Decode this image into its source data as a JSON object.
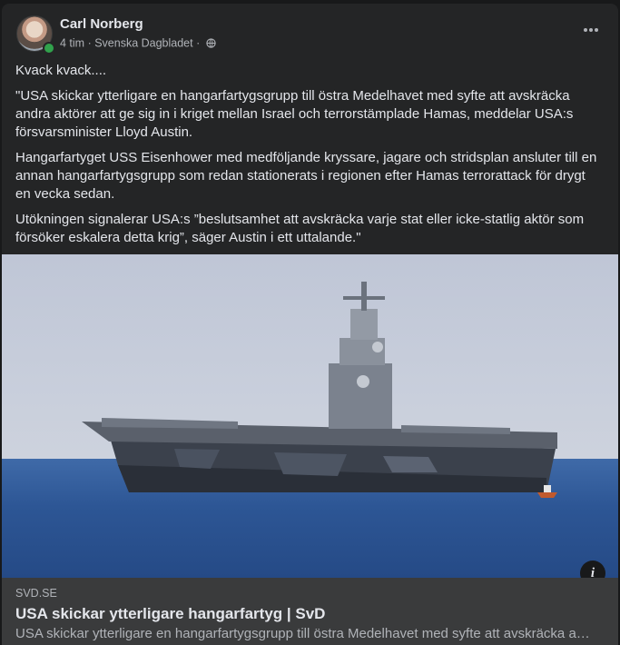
{
  "post": {
    "author": "Carl Norberg",
    "time": "4 tim",
    "separator": " · ",
    "source": "Svenska Dagbladet",
    "privacy_icon": "globe-icon",
    "more_icon": "more-horizontal-icon",
    "paragraphs": [
      "Kvack kvack....",
      "\"USA skickar ytterligare en hangarfartygsgrupp till östra Medelhavet med syfte att avskräcka andra aktörer att ge sig in i kriget mellan Israel och terrorstämplade Hamas, meddelar USA:s försvarsminister Lloyd Austin.",
      "Hangarfartyget USS Eisenhower med medföljande kryssare, jagare och stridsplan ansluter till en annan hangarfartygsgrupp som redan stationerats i regionen efter Hamas terrorattack för drygt en vecka sedan.",
      "Utökningen signalerar USA:s ”beslutsamhet att avskräcka varje stat eller icke-statlig aktör som försöker eskalera detta krig”, säger Austin i ett uttalande.\""
    ]
  },
  "link_preview": {
    "domain": "SVD.SE",
    "title": "USA skickar ytterligare hangarfartyg | SvD",
    "description": "USA skickar ytterligare en hangarfartygsgrupp till östra Medelhavet med syfte att avskräcka a…",
    "info_icon": "info-icon",
    "info_label": "i"
  },
  "colors": {
    "background": "#18191a",
    "card": "#242526",
    "link_box": "#3a3b3c",
    "online": "#31a24c"
  }
}
